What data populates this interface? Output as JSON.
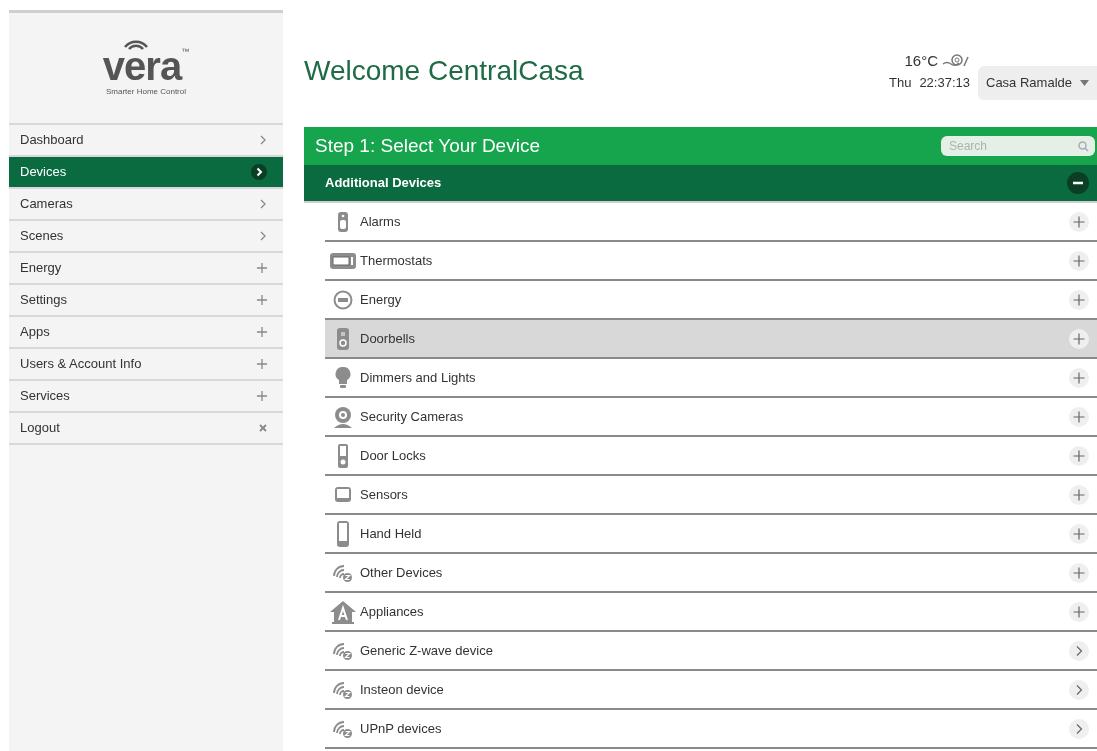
{
  "logo": {
    "name": "vera",
    "trademark": "™",
    "tagline": "Smarter Home Control"
  },
  "sidebar": {
    "items": [
      {
        "label": "Dashboard",
        "kind": "chevron",
        "selected": false
      },
      {
        "label": "Devices",
        "kind": "chevron",
        "selected": true
      },
      {
        "label": "Cameras",
        "kind": "chevron",
        "selected": false
      },
      {
        "label": "Scenes",
        "kind": "chevron",
        "selected": false
      },
      {
        "label": "Energy",
        "kind": "plus",
        "selected": false
      },
      {
        "label": "Settings",
        "kind": "plus",
        "selected": false
      },
      {
        "label": "Apps",
        "kind": "plus",
        "selected": false
      },
      {
        "label": "Users & Account Info",
        "kind": "plus",
        "selected": false
      },
      {
        "label": "Services",
        "kind": "plus",
        "selected": false
      },
      {
        "label": "Logout",
        "kind": "close",
        "selected": false
      }
    ]
  },
  "header": {
    "title": "Welcome CentralCasa",
    "temperature": "16°C",
    "day": "Thu",
    "time": "22:37:13",
    "location": "Casa Ramalde"
  },
  "step": {
    "title": "Step 1: Select Your Device",
    "search": {
      "placeholder": "Search"
    }
  },
  "group": {
    "title": "Additional Devices",
    "expanded": true
  },
  "devices": [
    {
      "label": "Alarms",
      "kind": "alarm",
      "submenu": false,
      "selected": false
    },
    {
      "label": "Thermostats",
      "kind": "thermostat",
      "submenu": false,
      "selected": false
    },
    {
      "label": "Energy",
      "kind": "energy",
      "submenu": false,
      "selected": false
    },
    {
      "label": "Doorbells",
      "kind": "doorbell",
      "submenu": false,
      "selected": true
    },
    {
      "label": "Dimmers and Lights",
      "kind": "bulb",
      "submenu": false,
      "selected": false
    },
    {
      "label": "Security Cameras",
      "kind": "camera",
      "submenu": false,
      "selected": false
    },
    {
      "label": "Door Locks",
      "kind": "lock",
      "submenu": false,
      "selected": false
    },
    {
      "label": "Sensors",
      "kind": "sensor",
      "submenu": false,
      "selected": false
    },
    {
      "label": "Hand Held",
      "kind": "remote",
      "submenu": false,
      "selected": false
    },
    {
      "label": "Other Devices",
      "kind": "wave",
      "submenu": false,
      "selected": false
    },
    {
      "label": "Appliances",
      "kind": "house",
      "submenu": false,
      "selected": false
    },
    {
      "label": "Generic Z-wave device",
      "kind": "wave",
      "submenu": true,
      "selected": false
    },
    {
      "label": "Insteon device",
      "kind": "wave",
      "submenu": true,
      "selected": false
    },
    {
      "label": "UPnP devices",
      "kind": "wave",
      "submenu": true,
      "selected": false
    }
  ]
}
